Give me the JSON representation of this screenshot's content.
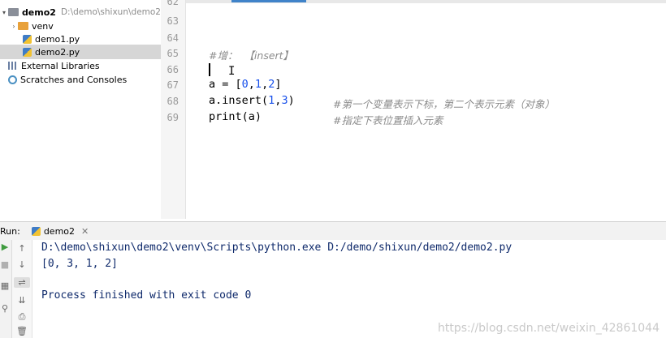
{
  "project_tree": {
    "root": {
      "name": "demo2",
      "path": "D:\\demo\\shixun\\demo2"
    },
    "items": [
      {
        "label": "venv",
        "type": "folder"
      },
      {
        "label": "demo1.py",
        "type": "file"
      },
      {
        "label": "demo2.py",
        "type": "file",
        "selected": true
      }
    ],
    "external_libraries": "External Libraries",
    "scratches": "Scratches and Consoles"
  },
  "editor": {
    "lines": [
      {
        "number": "62"
      },
      {
        "number": "63"
      },
      {
        "number": "64"
      },
      {
        "number": "65"
      },
      {
        "number": "66"
      },
      {
        "number": "67"
      },
      {
        "number": "68"
      },
      {
        "number": "69"
      }
    ],
    "code": {
      "line65_comment": "#增：  【insert】",
      "line67": {
        "prefix": "a = [",
        "nums": [
          "0",
          "1",
          "2"
        ],
        "suffix": "]"
      },
      "line68": {
        "prefix": "a.insert(",
        "nums": [
          "1",
          "3"
        ],
        "suffix": ")"
      },
      "line68_comment": "#第一个变量表示下标，第二个表示元素（对象）",
      "line69": "print(a)",
      "line69_comment": "#指定下表位置插入元素"
    }
  },
  "run_panel": {
    "label": "Run:",
    "tab": "demo2",
    "console": {
      "command": "D:\\demo\\shixun\\demo2\\venv\\Scripts\\python.exe D:/demo/shixun/demo2/demo2.py",
      "output": "[0, 3, 1, 2]",
      "exit": "Process finished with exit code 0"
    }
  },
  "watermark": "https://blog.csdn.net/weixin_42861044",
  "colors": {
    "folder": "#e8a13a",
    "folder_root": "#8a8f99",
    "selected_row": "#d6d6d6",
    "number": "#1750eb",
    "comment": "#8c8c8c",
    "console_text": "#0f2a6b",
    "run_green": "#3f9b3f"
  }
}
